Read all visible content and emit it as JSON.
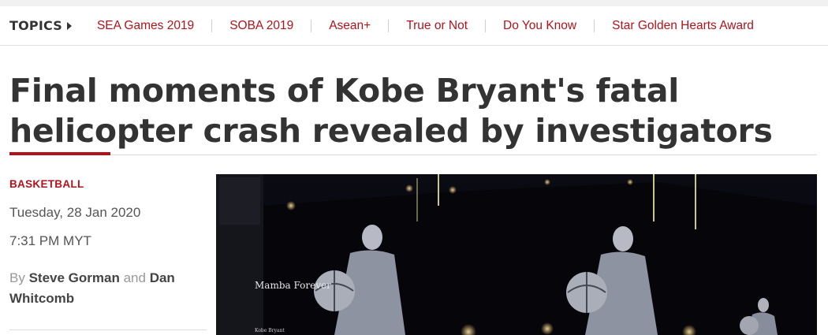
{
  "topics_bar": {
    "label": "TOPICS",
    "links": [
      "SEA Games 2019",
      "SOBA 2019",
      "Asean+",
      "True or Not",
      "Do You Know",
      "Star Golden Hearts Award"
    ]
  },
  "article": {
    "headline": "Final moments of Kobe Bryant's fatal helicopter crash revealed by investigators",
    "category": "BASKETBALL",
    "date": "Tuesday, 28 Jan 2020",
    "time": "7:31 PM MYT",
    "byline": {
      "prefix": "By",
      "author1": "Steve Gorman",
      "conjunction": "and",
      "author2": "Dan Whitcomb"
    }
  },
  "hero_image": {
    "billboard_text": "Mamba Forever",
    "small_text": "Kobe Bryant"
  },
  "colors": {
    "accent": "#b3121b",
    "text": "#333333",
    "muted": "#999999"
  }
}
